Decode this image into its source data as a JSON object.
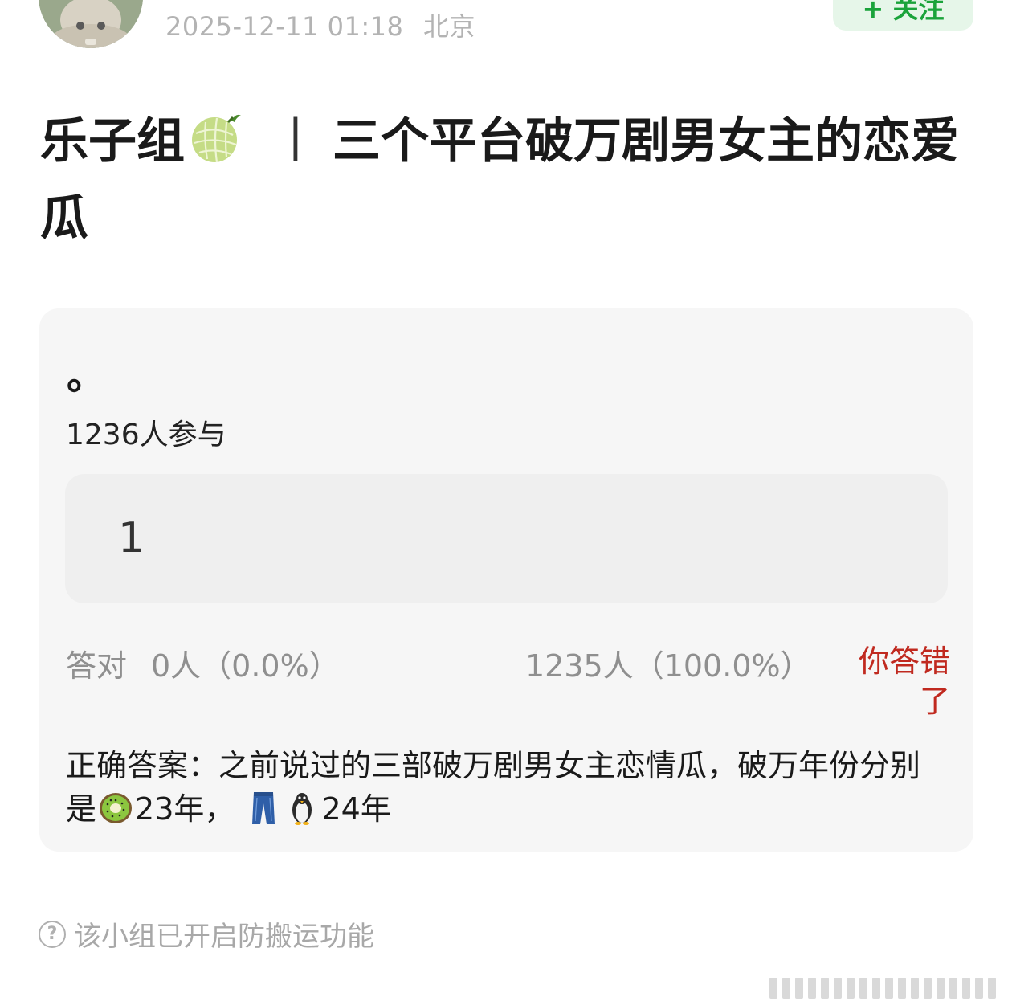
{
  "header": {
    "timestamp": "2025-12-11 01:18",
    "location": "北京",
    "follow_label": "+ 关注"
  },
  "post": {
    "title_prefix": "乐子组",
    "title_icon": "melon-icon",
    "title_separator": "丨",
    "title_main": "三个平台破万剧男女主的恋爱瓜"
  },
  "quiz": {
    "question": "。",
    "participants": "1236人参与",
    "option_label": "1",
    "correct_label": "答对",
    "correct_value": "0人（0.0%）",
    "wrong_value": "1235人（100.0%）",
    "result_badge": "你答错了",
    "answer_prefix": "正确答案：之前说过的三部破万剧男女主恋情瓜，破万年份分别是",
    "answer_part1": "23年，",
    "answer_part2": "24年",
    "answer_icons": [
      "kiwi-icon",
      "jeans-icon",
      "penguin-icon"
    ],
    "result_color": "#c0291f"
  },
  "footer": {
    "notice": "该小组已开启防搬运功能",
    "notice_icon": "question-circle-icon"
  },
  "colors": {
    "follow_bg": "#e6f6e9",
    "follow_text": "#1aa33a",
    "card_bg": "#f6f6f6"
  }
}
